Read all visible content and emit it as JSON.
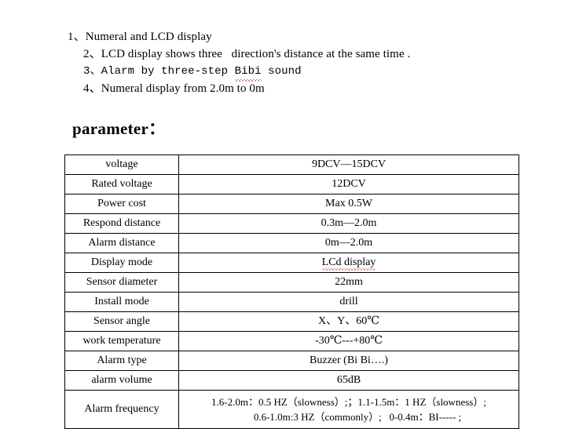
{
  "intro": {
    "lines": [
      {
        "num": "1、",
        "text": "Numeral and LCD display",
        "level": 1
      },
      {
        "num": "2、",
        "text": "LCD display shows three   direction's distance at the same time .",
        "level": 2
      },
      {
        "num": "3、",
        "text": "Alarm by three-step Bibi sound",
        "level": 2,
        "mono": true,
        "misspelled": "Bibi"
      },
      {
        "num": "4、",
        "text": "Numeral display from 2.0m to 0m",
        "level": 2
      }
    ],
    "line1_num": "1、",
    "line1_text": "Numeral and LCD display",
    "line2_num": "2、",
    "line2_text": "LCD display shows three   direction's distance at the same time .",
    "line3_num": "3、",
    "line3_pre": "Alarm by three-step ",
    "line3_misspelled": "Bibi",
    "line3_post": " sound",
    "line4_num": "4、",
    "line4_text": "Numeral display from 2.0m to 0m"
  },
  "heading": {
    "text": "parameter："
  },
  "table": {
    "rows": [
      {
        "label": "voltage",
        "value": "9DCV—15DCV"
      },
      {
        "label": "Rated voltage",
        "value": "12DCV"
      },
      {
        "label": "Power cost",
        "value": "Max 0.5W"
      },
      {
        "label": "Respond distance",
        "value": "0.3m—2.0m"
      },
      {
        "label": "Alarm distance",
        "value": "0m—2.0m"
      },
      {
        "label": "Display mode",
        "value": "LCd display",
        "value_misspelled": true
      },
      {
        "label": "Sensor diameter",
        "value": "22mm"
      },
      {
        "label": "Install mode",
        "value": "drill"
      },
      {
        "label": "Sensor angle",
        "value": "X、Y、60℃"
      },
      {
        "label": "work temperature",
        "value": "-30℃---+80℃"
      },
      {
        "label": "Alarm type",
        "value": "Buzzer (Bi Bi….)"
      },
      {
        "label": "alarm volume",
        "value": "65dB"
      }
    ],
    "r0_label": "voltage",
    "r0_value": "9DCV—15DCV",
    "r1_label": "Rated voltage",
    "r1_value": "12DCV",
    "r2_label": "Power cost",
    "r2_value": "Max 0.5W",
    "r3_label": "Respond distance",
    "r3_value": "0.3m—2.0m",
    "r4_label": "Alarm distance",
    "r4_value": "0m—2.0m",
    "r5_label": "Display mode",
    "r5_value": "LCd display",
    "r6_label": "Sensor diameter",
    "r6_value": "22mm",
    "r7_label": "Install mode",
    "r7_value": "drill",
    "r8_label": "Sensor angle",
    "r8_value": "X、Y、60℃",
    "r9_label": "work temperature",
    "r9_value": "-30℃---+80℃",
    "r10_label": "Alarm type",
    "r10_value": "Buzzer (Bi Bi….)",
    "r11_label": "alarm volume",
    "r11_value": "65dB",
    "r12_label": "Alarm frequency",
    "r12_value_line1": "1.6-2.0m：0.5 HZ（slowness）;；1.1-1.5m：1 HZ（slowness）;",
    "r12_value_line2": "0.6-1.0m:3 HZ（commonly）;   0-0.4m：BI----- ;"
  },
  "colors": {
    "text": "#000000",
    "border": "#000000",
    "background": "#ffffff",
    "spellcheck_underline": "#c0392b"
  }
}
